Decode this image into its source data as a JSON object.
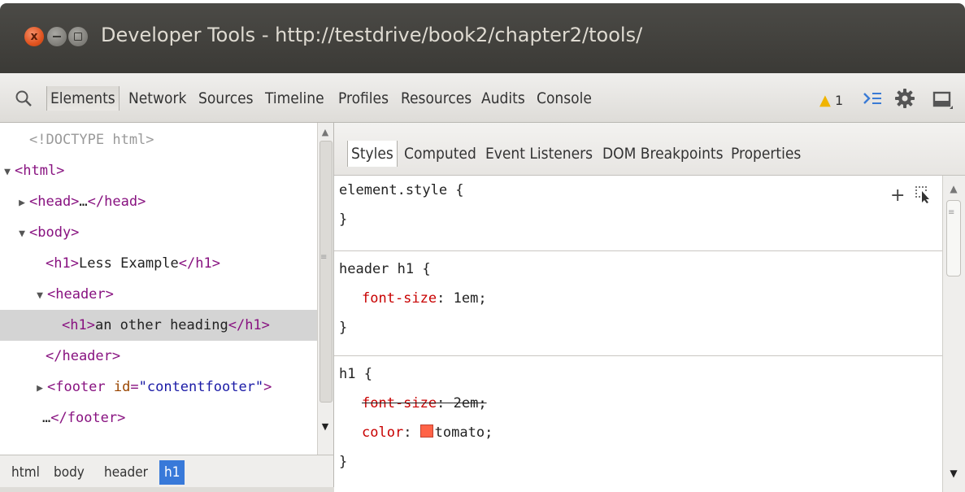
{
  "window": {
    "title": "Developer Tools - http://testdrive/book2/chapter2/tools/",
    "close_glyph": "x"
  },
  "toolbar": {
    "tabs": [
      "Elements",
      "Network",
      "Sources",
      "Timeline",
      "Profiles",
      "Resources",
      "Audits",
      "Console"
    ],
    "active_tab": "Elements",
    "warning_count": "1",
    "icons": [
      "search-icon",
      "warning-icon",
      "console-drawer-icon",
      "gear-icon",
      "dock-icon"
    ]
  },
  "elements": {
    "lines": [
      {
        "doctype": "<!DOCTYPE html>"
      },
      {
        "arrow": "▼",
        "open": "<html>"
      },
      {
        "arrow": "▶",
        "open": "<head>",
        "text": "…",
        "close": "</head>"
      },
      {
        "arrow": "▼",
        "open": "<body>"
      },
      {
        "open": "<h1>",
        "text": "Less Example",
        "close": "</h1>"
      },
      {
        "arrow": "▼",
        "open": "<header>"
      },
      {
        "open": "<h1>",
        "text": "an other heading",
        "close": "</h1>",
        "selected": true
      },
      {
        "close": "</header>"
      },
      {
        "arrow": "▶",
        "open_pre": "<footer ",
        "attr": "id",
        "eq": "=",
        "val": "\"contentfooter\"",
        "open_post": ">"
      },
      {
        "text": "…",
        "close": "</footer>"
      }
    ]
  },
  "breadcrumb": {
    "items": [
      "html",
      "body",
      "header",
      "h1"
    ],
    "active": "h1"
  },
  "sidebar": {
    "tabs": [
      "Styles",
      "Computed",
      "Event Listeners",
      "DOM Breakpoints",
      "Properties"
    ],
    "active_tab": "Styles",
    "rules": [
      {
        "selector": "element.style {",
        "close": "}",
        "props": []
      },
      {
        "selector": "header h1 {",
        "close": "}",
        "props": [
          {
            "name": "font-size",
            "value": "1em;",
            "overridden": false
          }
        ]
      },
      {
        "selector": "h1 {",
        "close": "}",
        "props": [
          {
            "name": "font-size",
            "value": "2em;",
            "overridden": true
          },
          {
            "name": "color",
            "value": "tomato;",
            "overridden": false,
            "swatch": "#ff6347"
          }
        ]
      }
    ],
    "add_rule_glyph": "+"
  },
  "colors": {
    "accent": "#3879d9",
    "tag": "#881280",
    "property": "#c80000",
    "attr_value": "#1a1aa6",
    "warning": "#f0b400"
  }
}
